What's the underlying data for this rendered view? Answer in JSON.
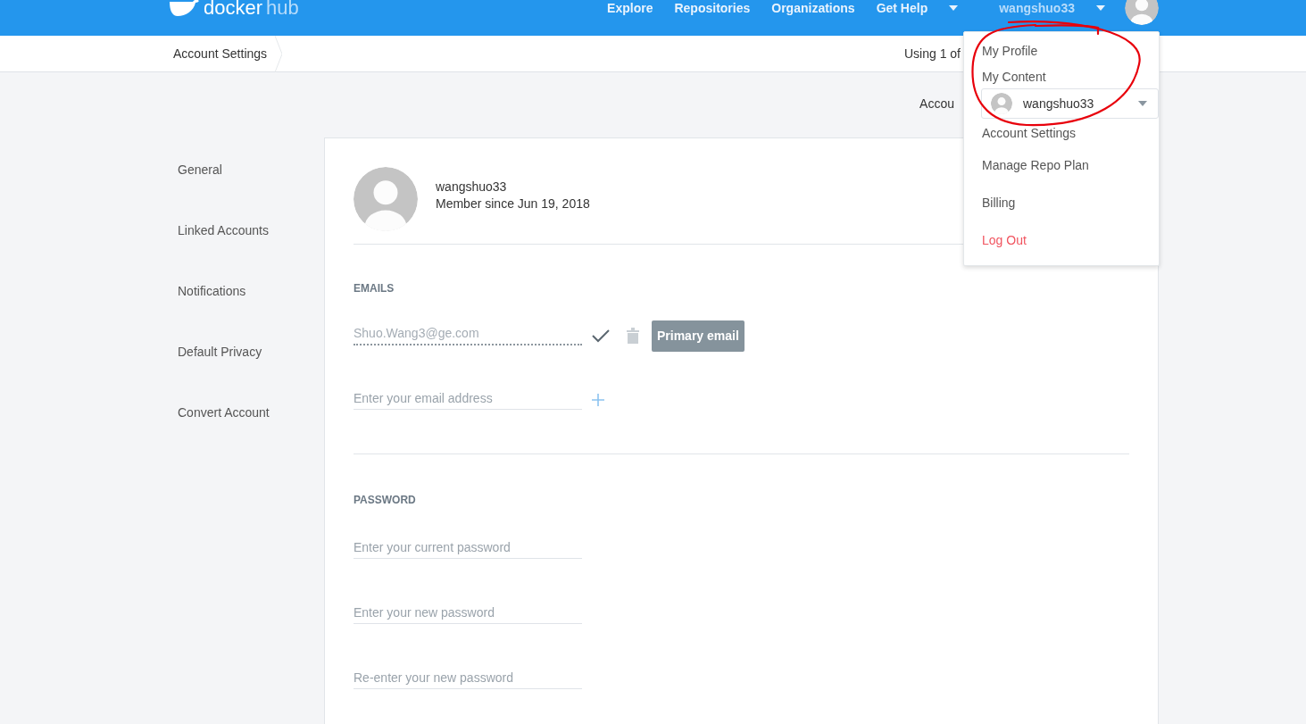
{
  "nav": {
    "logo_word": "docker",
    "logo_suffix": "hub",
    "links": [
      {
        "label": "Explore",
        "dropdown": false
      },
      {
        "label": "Repositories",
        "dropdown": false
      },
      {
        "label": "Organizations",
        "dropdown": false
      },
      {
        "label": "Get Help",
        "dropdown": true
      }
    ],
    "user": "wangshuo33"
  },
  "subbar": {
    "breadcrumb": "Account Settings",
    "usage": "Using 1 of"
  },
  "account_switch": {
    "label": "Accou",
    "selected_account": "wangshuo33"
  },
  "sidebar": {
    "items": [
      "General",
      "Linked Accounts",
      "Notifications",
      "Default Privacy",
      "Convert Account"
    ]
  },
  "profile": {
    "username": "wangshuo33",
    "member_since": "Member since Jun 19, 2018"
  },
  "emails": {
    "heading": "EMAILS",
    "items": [
      {
        "value": "Shuo.Wang3@ge.com",
        "verified": true,
        "primary": true,
        "badge": "Primary email"
      }
    ],
    "new_placeholder": "Enter your email address"
  },
  "password": {
    "heading": "PASSWORD",
    "placeholders": [
      "Enter your current password",
      "Enter your new password",
      "Re-enter your new password"
    ]
  },
  "user_menu": {
    "items": [
      {
        "label": "My Profile",
        "kind": "normal"
      },
      {
        "label": "My Content",
        "kind": "normal"
      },
      {
        "label": "Account Settings",
        "kind": "normal"
      },
      {
        "label": "Manage Repo Plan",
        "kind": "normal"
      },
      {
        "label": "Billing",
        "kind": "normal"
      },
      {
        "label": "Log Out",
        "kind": "danger"
      }
    ]
  }
}
